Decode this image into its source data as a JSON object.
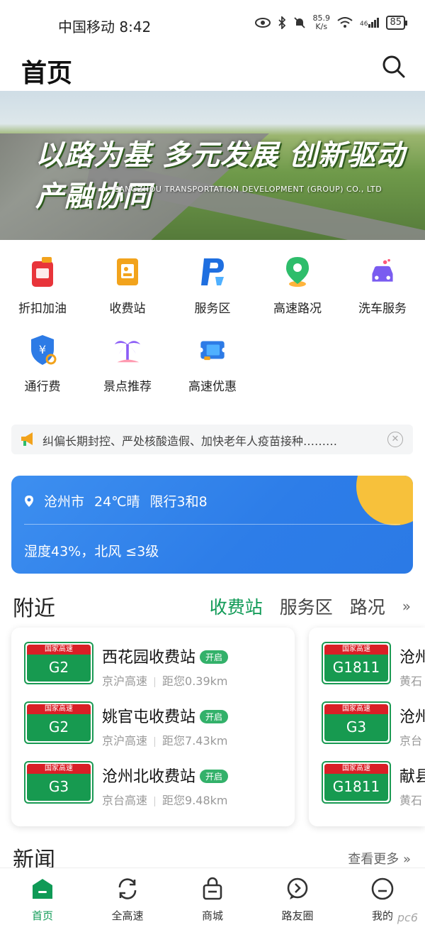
{
  "status_bar": {
    "carrier_time": "中国移动 8:42",
    "net_speed_value": "85.9",
    "net_speed_unit": "K/s",
    "signal": "46",
    "battery": "85"
  },
  "header": {
    "title": "首页"
  },
  "banner": {
    "slogan": "以路为基 多元发展 创新驱动 产融协同",
    "company": "CANGZHOU TRANSPORTATION DEVELOPMENT (GROUP) CO., LTD"
  },
  "services": [
    {
      "label": "折扣加油",
      "icon": "fuel-can-icon",
      "color": "#e8343a"
    },
    {
      "label": "收费站",
      "icon": "toll-booth-icon",
      "color": "#f2a31c"
    },
    {
      "label": "服务区",
      "icon": "service-area-icon",
      "color": "#1f6fe0"
    },
    {
      "label": "高速路况",
      "icon": "location-pin-icon",
      "color": "#2ebd6b"
    },
    {
      "label": "洗车服务",
      "icon": "car-wash-icon",
      "color": "#7a5cf0"
    },
    {
      "label": "通行费",
      "icon": "toll-fee-shield-icon",
      "color": "#2d7be6"
    },
    {
      "label": "景点推荐",
      "icon": "palm-tree-icon",
      "color": "#8b5cf6"
    },
    {
      "label": "高速优惠",
      "icon": "discount-ticket-icon",
      "color": "#2d7be6"
    }
  ],
  "notice": {
    "text": "纠偏长期封控、严处核酸造假、加快老年人疫苗接种………"
  },
  "weather": {
    "city": "沧州市",
    "condition": "24℃晴",
    "restriction": "限行3和8",
    "detail": "湿度43%，北风 ≤3级"
  },
  "nearby": {
    "title": "附近",
    "tabs": [
      "收费站",
      "服务区",
      "路况"
    ],
    "active_tab": 0
  },
  "stations_left": [
    {
      "plate_top": "国家高速",
      "code": "G2",
      "name": "西花园收费站",
      "badge": "开启",
      "road": "京沪高速",
      "distance": "距您0.39km"
    },
    {
      "plate_top": "国家高速",
      "code": "G2",
      "name": "姚官屯收费站",
      "badge": "开启",
      "road": "京沪高速",
      "distance": "距您7.43km"
    },
    {
      "plate_top": "国家高速",
      "code": "G3",
      "name": "沧州北收费站",
      "badge": "开启",
      "road": "京台高速",
      "distance": "距您9.48km"
    }
  ],
  "stations_right": [
    {
      "plate_top": "国家高速",
      "code": "G1811",
      "name": "沧州",
      "road": "黄石"
    },
    {
      "plate_top": "国家高速",
      "code": "G3",
      "name": "沧州",
      "road": "京台"
    },
    {
      "plate_top": "国家高速",
      "code": "G1811",
      "name": "献县",
      "road": "黄石"
    }
  ],
  "news": {
    "title": "新闻",
    "more": "查看更多 »"
  },
  "tabbar": [
    {
      "label": "首页",
      "icon": "home-icon",
      "active": true
    },
    {
      "label": "全高速",
      "icon": "refresh-icon",
      "active": false
    },
    {
      "label": "商城",
      "icon": "shop-bag-icon",
      "active": false
    },
    {
      "label": "路友圈",
      "icon": "chat-bubble-icon",
      "active": false
    },
    {
      "label": "我的",
      "icon": "profile-icon",
      "active": false
    }
  ],
  "watermark": "pc6"
}
